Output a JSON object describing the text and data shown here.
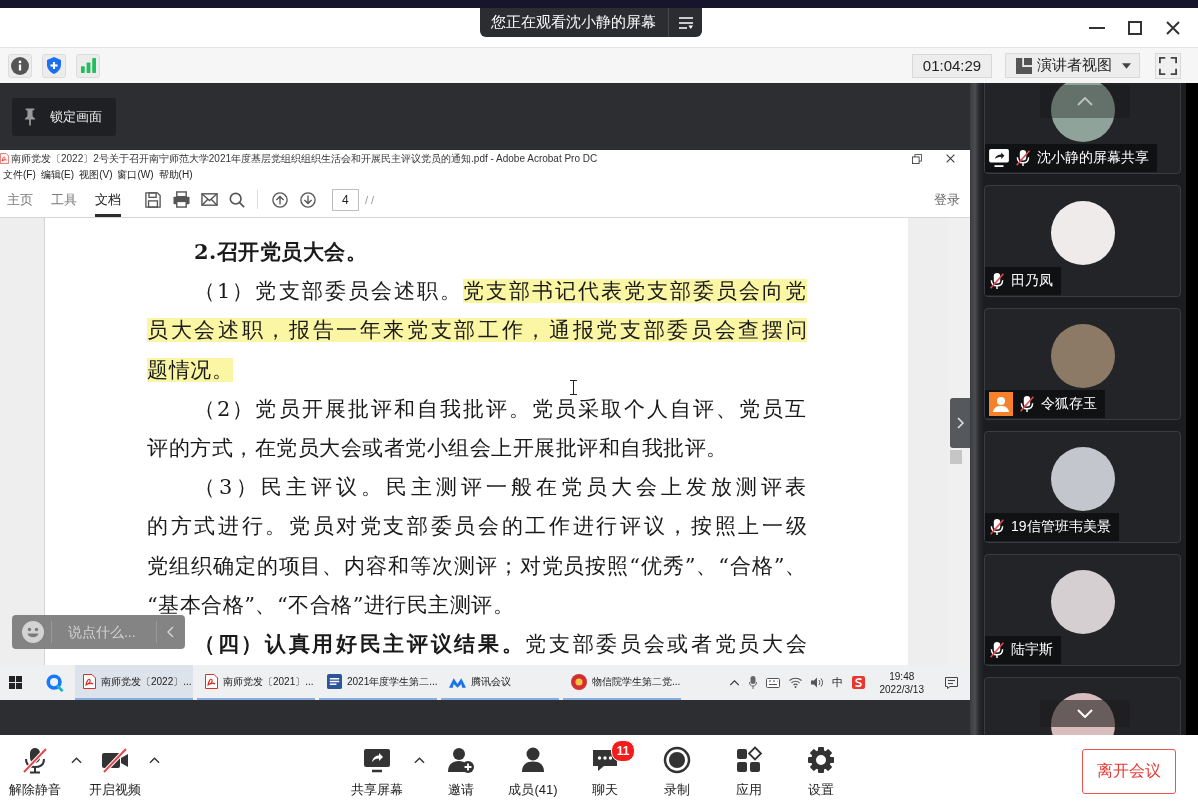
{
  "banner": {
    "text": "您正在观看沈小静的屏幕"
  },
  "meeting_bar": {
    "timer": "01:04:29",
    "view": "演讲者视图"
  },
  "lock_button": "锁定画面",
  "pdf_window": {
    "title": "南师党发〔2022〕2号关于召开南宁师范大学2021年度基层党组织组织生活会和开展民主评议党员的通知.pdf - Adobe Acrobat Pro DC",
    "menu": [
      "文件(F)",
      "编辑(E)",
      "视图(V)",
      "窗口(W)",
      "帮助(H)"
    ],
    "tabs": [
      {
        "label": "主页",
        "selected": false
      },
      {
        "label": "工具",
        "selected": false
      },
      {
        "label": "文档",
        "selected": true
      }
    ],
    "page_number": "4",
    "page_total": "/ /",
    "sign_in": "登录",
    "paragraphs": [
      {
        "kind": "heading",
        "cut_off": false,
        "lines": [
          {
            "segments": [
              {
                "text": "2.召开党员大会。",
                "highlighted": false
              }
            ]
          }
        ]
      },
      {
        "kind": "body",
        "cut_off": false,
        "lines": [
          {
            "segments": [
              {
                "text": "（1）党支部委员会述职。",
                "highlighted": false
              },
              {
                "text": "党支部书记代表党支部委员会向党",
                "highlighted": true
              }
            ]
          },
          {
            "segments": [
              {
                "text": "员大会述职，报告一年来党支部工作，通报党支部委员会查摆问",
                "highlighted": true
              }
            ]
          },
          {
            "segments": [
              {
                "text": "题情况。",
                "highlighted": true
              }
            ]
          }
        ]
      },
      {
        "kind": "body",
        "cut_off": false,
        "lines": [
          {
            "segments": [
              {
                "text": "（2）党员开展批评和自我批评。党员采取个人自评、党员互",
                "highlighted": false
              }
            ]
          },
          {
            "segments": [
              {
                "text": "评的方式，在党员大会或者党小组会上开展批评和自我批评。",
                "highlighted": false
              }
            ]
          }
        ]
      },
      {
        "kind": "body",
        "cut_off": false,
        "lines": [
          {
            "segments": [
              {
                "text": "（3）民主评议。民主测评一般在党员大会上发放测评表",
                "highlighted": false
              }
            ]
          },
          {
            "segments": [
              {
                "text": "的方式进行。党员对党支部委员会的工作进行评议，按照上一级",
                "highlighted": false
              }
            ]
          },
          {
            "segments": [
              {
                "text": "党组织确定的项目、内容和等次测评；对党员按照“优秀”、“合格”、",
                "highlighted": false
              }
            ]
          },
          {
            "segments": [
              {
                "text": "“基本合格”、“不合格”进行民主测评。",
                "highlighted": false
              }
            ]
          }
        ]
      },
      {
        "kind": "body",
        "cut_off": true,
        "lines": [
          {
            "segments": [
              {
                "text": "**（四）认真用好民主评议结果。**党支部委员会或者党员大会",
                "highlighted": false
              }
            ]
          }
        ]
      }
    ]
  },
  "taskbar": {
    "apps": [
      {
        "kind": "pdf",
        "label": "南师党发〔2022〕...",
        "selected": true
      },
      {
        "kind": "pdf",
        "label": "南师党发〔2021〕...",
        "selected": false
      },
      {
        "kind": "word",
        "label": "2021年度学生第二...",
        "selected": false
      },
      {
        "kind": "meeting",
        "label": "腾讯会议",
        "selected": false
      },
      {
        "kind": "chat",
        "label": "物信院学生第二党...",
        "selected": false
      }
    ],
    "input_method": "中",
    "time": "19:48",
    "date": "2022/3/13"
  },
  "chat": {
    "placeholder": "说点什么..."
  },
  "participants": [
    {
      "name": "沈小静的屏幕共享",
      "muted": true,
      "sharing": true,
      "host": false,
      "color": "#8fa39a"
    },
    {
      "name": "田乃凤",
      "muted": true,
      "sharing": false,
      "host": false,
      "color": "#efebeb"
    },
    {
      "name": "令狐存玉",
      "muted": true,
      "sharing": false,
      "host": true,
      "color": "#8c7a66"
    },
    {
      "name": "19信管班韦美景",
      "muted": true,
      "sharing": false,
      "host": false,
      "color": "#c3c6cc"
    },
    {
      "name": "陆宇斯",
      "muted": true,
      "sharing": false,
      "host": false,
      "color": "#d6cfd2"
    },
    {
      "color": "#d9bcbc"
    }
  ],
  "controls": {
    "left": [
      {
        "kind": "mic",
        "label": "解除静音",
        "off": true,
        "has_menu": true
      },
      {
        "kind": "camera",
        "label": "开启视频",
        "off": true,
        "has_menu": true
      }
    ],
    "center": [
      {
        "kind": "share",
        "label": "共享屏幕",
        "has_menu": true
      },
      {
        "kind": "invite",
        "label": "邀请",
        "has_menu": false
      },
      {
        "kind": "members",
        "label": "成员(41)",
        "has_menu": false
      },
      {
        "kind": "chat",
        "label": "聊天",
        "badge": "11",
        "has_menu": false
      },
      {
        "kind": "record",
        "label": "录制",
        "has_menu": false
      },
      {
        "kind": "apps",
        "label": "应用",
        "has_menu": false
      },
      {
        "kind": "settings",
        "label": "设置",
        "has_menu": false
      }
    ]
  },
  "leave_button": "离开会议"
}
